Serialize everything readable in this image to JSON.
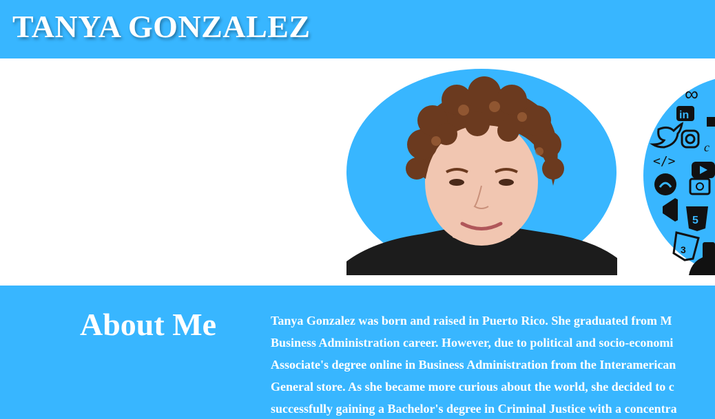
{
  "header": {
    "title": "TANYA GONZALEZ",
    "background": "#38b6ff"
  },
  "hero": {
    "portrait": {
      "icon": "portrait-photo",
      "background": "#38b6ff"
    },
    "tech_icons_image": {
      "icons": [
        "linkedin-icon",
        "twitter-icon",
        "instagram-icon",
        "code-icon",
        "github-icon",
        "youtube-icon",
        "camera-icon",
        "vscode-icon",
        "html5-icon",
        "css3-icon"
      ]
    }
  },
  "about": {
    "heading": "About Me",
    "lines": [
      "Tanya Gonzalez was born and raised in Puerto Rico. She graduated from M",
      "Business Administration career. However, due to political and socio-economi",
      "Associate's degree online in Business Administration from the Interamerican",
      "General store. As she became more curious about the world, she decided to c",
      "successfully gaining a Bachelor's degree in Criminal Justice with a concentra"
    ]
  }
}
